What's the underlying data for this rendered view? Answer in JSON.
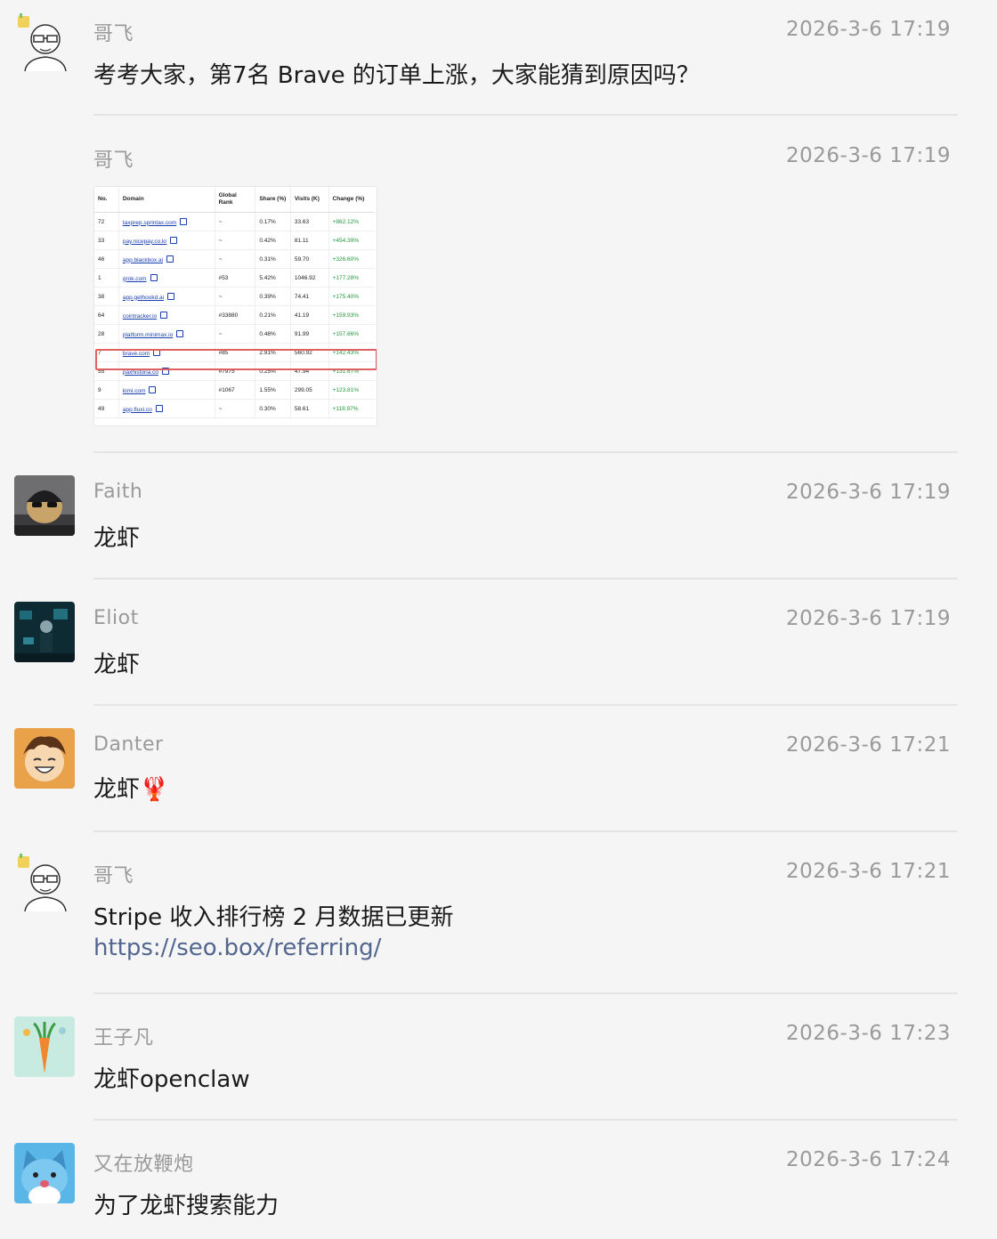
{
  "messages": [
    {
      "sender": "哥飞",
      "time": "2026-3-6 17:19",
      "text": "考考大家，第7名 Brave 的订单上涨，大家能猜到原因吗？"
    },
    {
      "sender": "哥飞",
      "time": "2026-3-6 17:19",
      "image_table": {
        "headers": [
          "No.",
          "Domain",
          "Global Rank",
          "Share (%)",
          "Visits (K)",
          "Change (%)"
        ],
        "rows": [
          [
            "72",
            "taxprep.sprintax.com",
            "~",
            "0.17%",
            "33.63",
            "+862.12%"
          ],
          [
            "33",
            "pay.nicepay.co.kr",
            "~",
            "0.42%",
            "81.11",
            "+454.39%"
          ],
          [
            "46",
            "app.blackbox.ai",
            "~",
            "0.31%",
            "59.70",
            "+326.60%"
          ],
          [
            "1",
            "grok.com",
            "#53",
            "5.42%",
            "1046.92",
            "+177.28%"
          ],
          [
            "38",
            "app.gethookd.ai",
            "~",
            "0.39%",
            "74.41",
            "+175.40%"
          ],
          [
            "64",
            "cointracker.io",
            "#33880",
            "0.21%",
            "41.19",
            "+159.93%"
          ],
          [
            "28",
            "platform.minimax.io",
            "~",
            "0.48%",
            "91.99",
            "+157.66%"
          ],
          [
            "7",
            "brave.com",
            "#85",
            "2.91%",
            "560.92",
            "+142.43%"
          ],
          [
            "55",
            "paxhistoria.co",
            "#7975",
            "0.25%",
            "47.94",
            "+131.67%"
          ],
          [
            "9",
            "kimi.com",
            "#1067",
            "1.55%",
            "299.05",
            "+123.81%"
          ],
          [
            "49",
            "app.fluxi.co",
            "~",
            "0.30%",
            "58.61",
            "+118.97%"
          ]
        ],
        "highlight_row": 7
      }
    },
    {
      "sender": "Faith",
      "time": "2026-3-6 17:19",
      "text": "龙虾"
    },
    {
      "sender": "Eliot",
      "time": "2026-3-6 17:19",
      "text": "龙虾"
    },
    {
      "sender": "Danter",
      "time": "2026-3-6 17:21",
      "text": "龙虾🦞"
    },
    {
      "sender": "哥飞",
      "time": "2026-3-6 17:21",
      "text": "Stripe 收入排行榜 2 月数据已更新",
      "link": "https://seo.box/referring/"
    },
    {
      "sender": "王子凡",
      "time": "2026-3-6 17:23",
      "text": "龙虾openclaw"
    },
    {
      "sender": "又在放鞭炮",
      "time": "2026-3-6 17:24",
      "text": "为了龙虾搜索能力"
    }
  ],
  "colors": {
    "background": "#f5f5f5",
    "meta": "#9a9a9a",
    "text": "#1a1a1a",
    "link": "#53668f",
    "change": "#1f9a3a",
    "highlight": "#e06060"
  }
}
